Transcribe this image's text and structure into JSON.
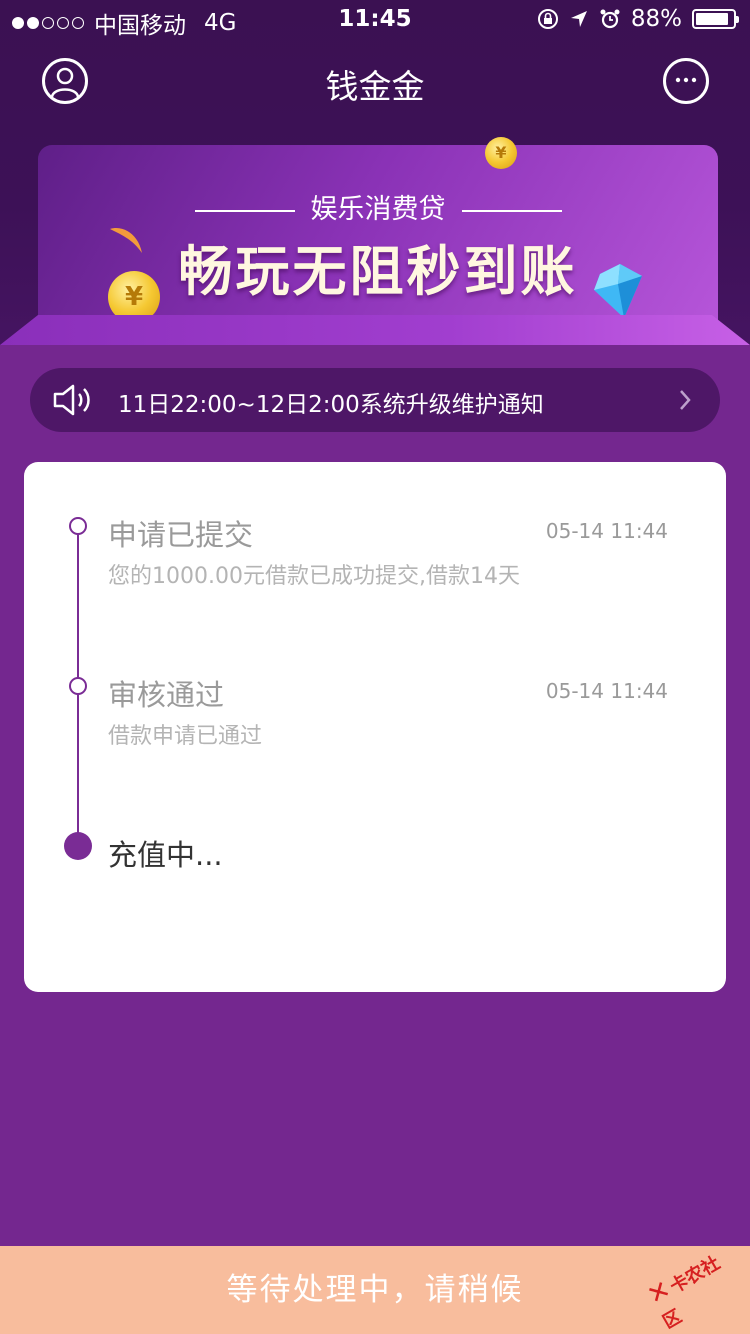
{
  "status_bar": {
    "carrier": "中国移动",
    "network": "4G",
    "time": "11:45",
    "battery": "88%",
    "battery_level": 0.88
  },
  "nav": {
    "title": "钱金金",
    "left_icon": "user-icon",
    "right_icon": "chat-icon"
  },
  "banner": {
    "subtitle": "娱乐消费贷",
    "headline": "畅玩无阻秒到账",
    "coin_symbol": "¥"
  },
  "notice": {
    "text": "11日22:00~12日2:00系统升级维护通知"
  },
  "timeline": {
    "steps": [
      {
        "title": "申请已提交",
        "desc": "您的1000.00元借款已成功提交,借款14天",
        "time": "05-14 11:44"
      },
      {
        "title": "审核通过",
        "desc": "借款申请已通过",
        "time": "05-14 11:44"
      },
      {
        "title": "充值中...",
        "desc": "",
        "time": ""
      }
    ]
  },
  "bottom": {
    "status": "等待处理中，请稍候"
  },
  "watermark": {
    "text": "卡农社区"
  },
  "colors": {
    "header_bg": "#3d1157",
    "page_bg": "#74278f",
    "accent": "#7a2c95",
    "bottom_bg": "#f8bd9d"
  }
}
